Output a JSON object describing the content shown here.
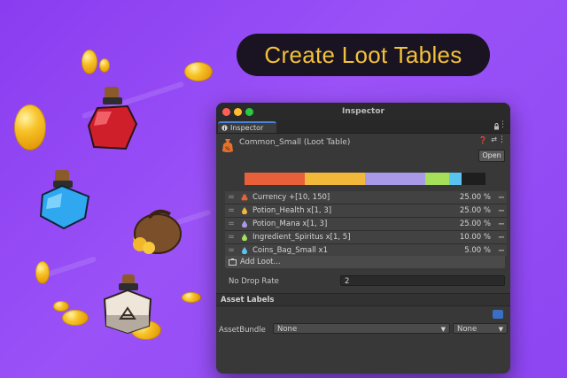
{
  "banner": {
    "text": "Create Loot Tables"
  },
  "window": {
    "title": "Inspector",
    "tab_label": "Inspector",
    "object_title": "Common_Small (Loot Table)",
    "open_label": "Open",
    "distribution": [
      {
        "color": "#e8603a",
        "fraction": 0.25
      },
      {
        "color": "#f2b83a",
        "fraction": 0.25
      },
      {
        "color": "#a89ae6",
        "fraction": 0.25
      },
      {
        "color": "#a6e05a",
        "fraction": 0.1
      },
      {
        "color": "#59c4ef",
        "fraction": 0.05
      }
    ],
    "rows": [
      {
        "name": "Currency +[10, 150]",
        "pct": "25.00 %",
        "color": "#e8603a",
        "icon": "coins-icon"
      },
      {
        "name": "Potion_Health x[1, 3]",
        "pct": "25.00 %",
        "color": "#f2b83a",
        "icon": "drop-icon"
      },
      {
        "name": "Potion_Mana x[1, 3]",
        "pct": "25.00 %",
        "color": "#a89ae6",
        "icon": "drop-icon"
      },
      {
        "name": "Ingredient_Spiritus x[1, 5]",
        "pct": "10.00 %",
        "color": "#a6e05a",
        "icon": "drop-icon"
      },
      {
        "name": "Coins_Bag_Small x1",
        "pct": "5.00 %",
        "color": "#59c4ef",
        "icon": "drop-icon"
      }
    ],
    "add_loot_label": "Add Loot...",
    "no_drop_label": "No Drop Rate",
    "no_drop_value": "2",
    "asset_labels_header": "Asset Labels",
    "assetbundle_label": "AssetBundle",
    "assetbundle_value": "None",
    "variant_value": "None"
  }
}
